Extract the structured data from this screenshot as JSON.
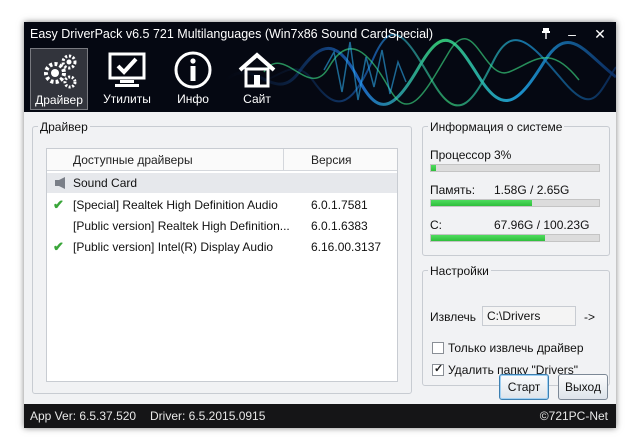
{
  "window": {
    "title": "Easy DriverPack v6.5 721 Multilanguages (Win7x86 Sound CardSpecial)",
    "pin_icon": "pin-icon",
    "minimize_label": "–",
    "close_label": "✕"
  },
  "toolbar": {
    "items": [
      {
        "label": "Драйвер",
        "icon": "gears-icon",
        "active": true
      },
      {
        "label": "Утилиты",
        "icon": "monitor-check-icon",
        "active": false
      },
      {
        "label": "Инфо",
        "icon": "info-icon",
        "active": false
      },
      {
        "label": "Сайт",
        "icon": "home-icon",
        "active": false
      }
    ]
  },
  "drivers": {
    "group_title": "Драйвер",
    "columns": {
      "name": "Доступные драйверы",
      "version": "Версия"
    },
    "category": "Sound Card",
    "rows": [
      {
        "name": "[Special] Realtek High Definition Audio",
        "version": "6.0.1.7581",
        "checked": true
      },
      {
        "name": "[Public version] Realtek High Definition...",
        "version": "6.0.1.6383",
        "checked": false
      },
      {
        "name": "[Public version] Intel(R) Display Audio",
        "version": "6.16.00.3137",
        "checked": true
      }
    ]
  },
  "sysinfo": {
    "title": "Информация о системе",
    "cpu_label": "Процессор",
    "cpu_value": "3%",
    "cpu_fraction": 0.03,
    "memory_label": "Память:",
    "memory_value": "1.58G / 2.65G",
    "memory_fraction": 0.6,
    "disk_label": "C:",
    "disk_value": "67.96G / 100.23G",
    "disk_fraction": 0.68
  },
  "settings": {
    "title": "Настройки",
    "extract_label": "Извлечь",
    "extract_path": "C:\\Drivers",
    "browse_label": "->",
    "only_extract_label": "Только извлечь драйвер",
    "only_extract_checked": false,
    "delete_folder_label": "Удалить папку \"Drivers\"",
    "delete_folder_checked": true
  },
  "buttons": {
    "start": "Старт",
    "exit": "Выход"
  },
  "status": {
    "app_version": "App Ver: 6.5.37.520",
    "driver_version": "Driver: 6.5.2015.0915",
    "copyright": "©721PC-Net"
  },
  "colors": {
    "progress": "#2fbf3c",
    "header": "#050812",
    "check": "#3aa63a"
  }
}
